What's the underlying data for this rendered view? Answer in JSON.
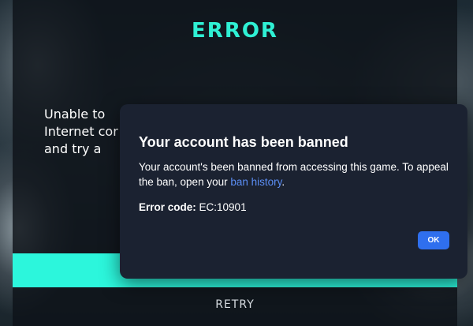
{
  "error_screen": {
    "title": "ERROR",
    "message": "Unable to\nInternet cor\nand try a",
    "retry_label": "RETRY",
    "accent_color": "#2ff0d4"
  },
  "dialog": {
    "title": "Your account has been banned",
    "body_text": "Your account's been banned from accessing this game. To appeal the ban, open your ",
    "link_text": "ban history",
    "body_end": ".",
    "code_label": "Error code:",
    "code_value": " EC:10901",
    "ok_label": "OK",
    "background_color": "#1b2231",
    "button_color": "#2f6fee"
  }
}
